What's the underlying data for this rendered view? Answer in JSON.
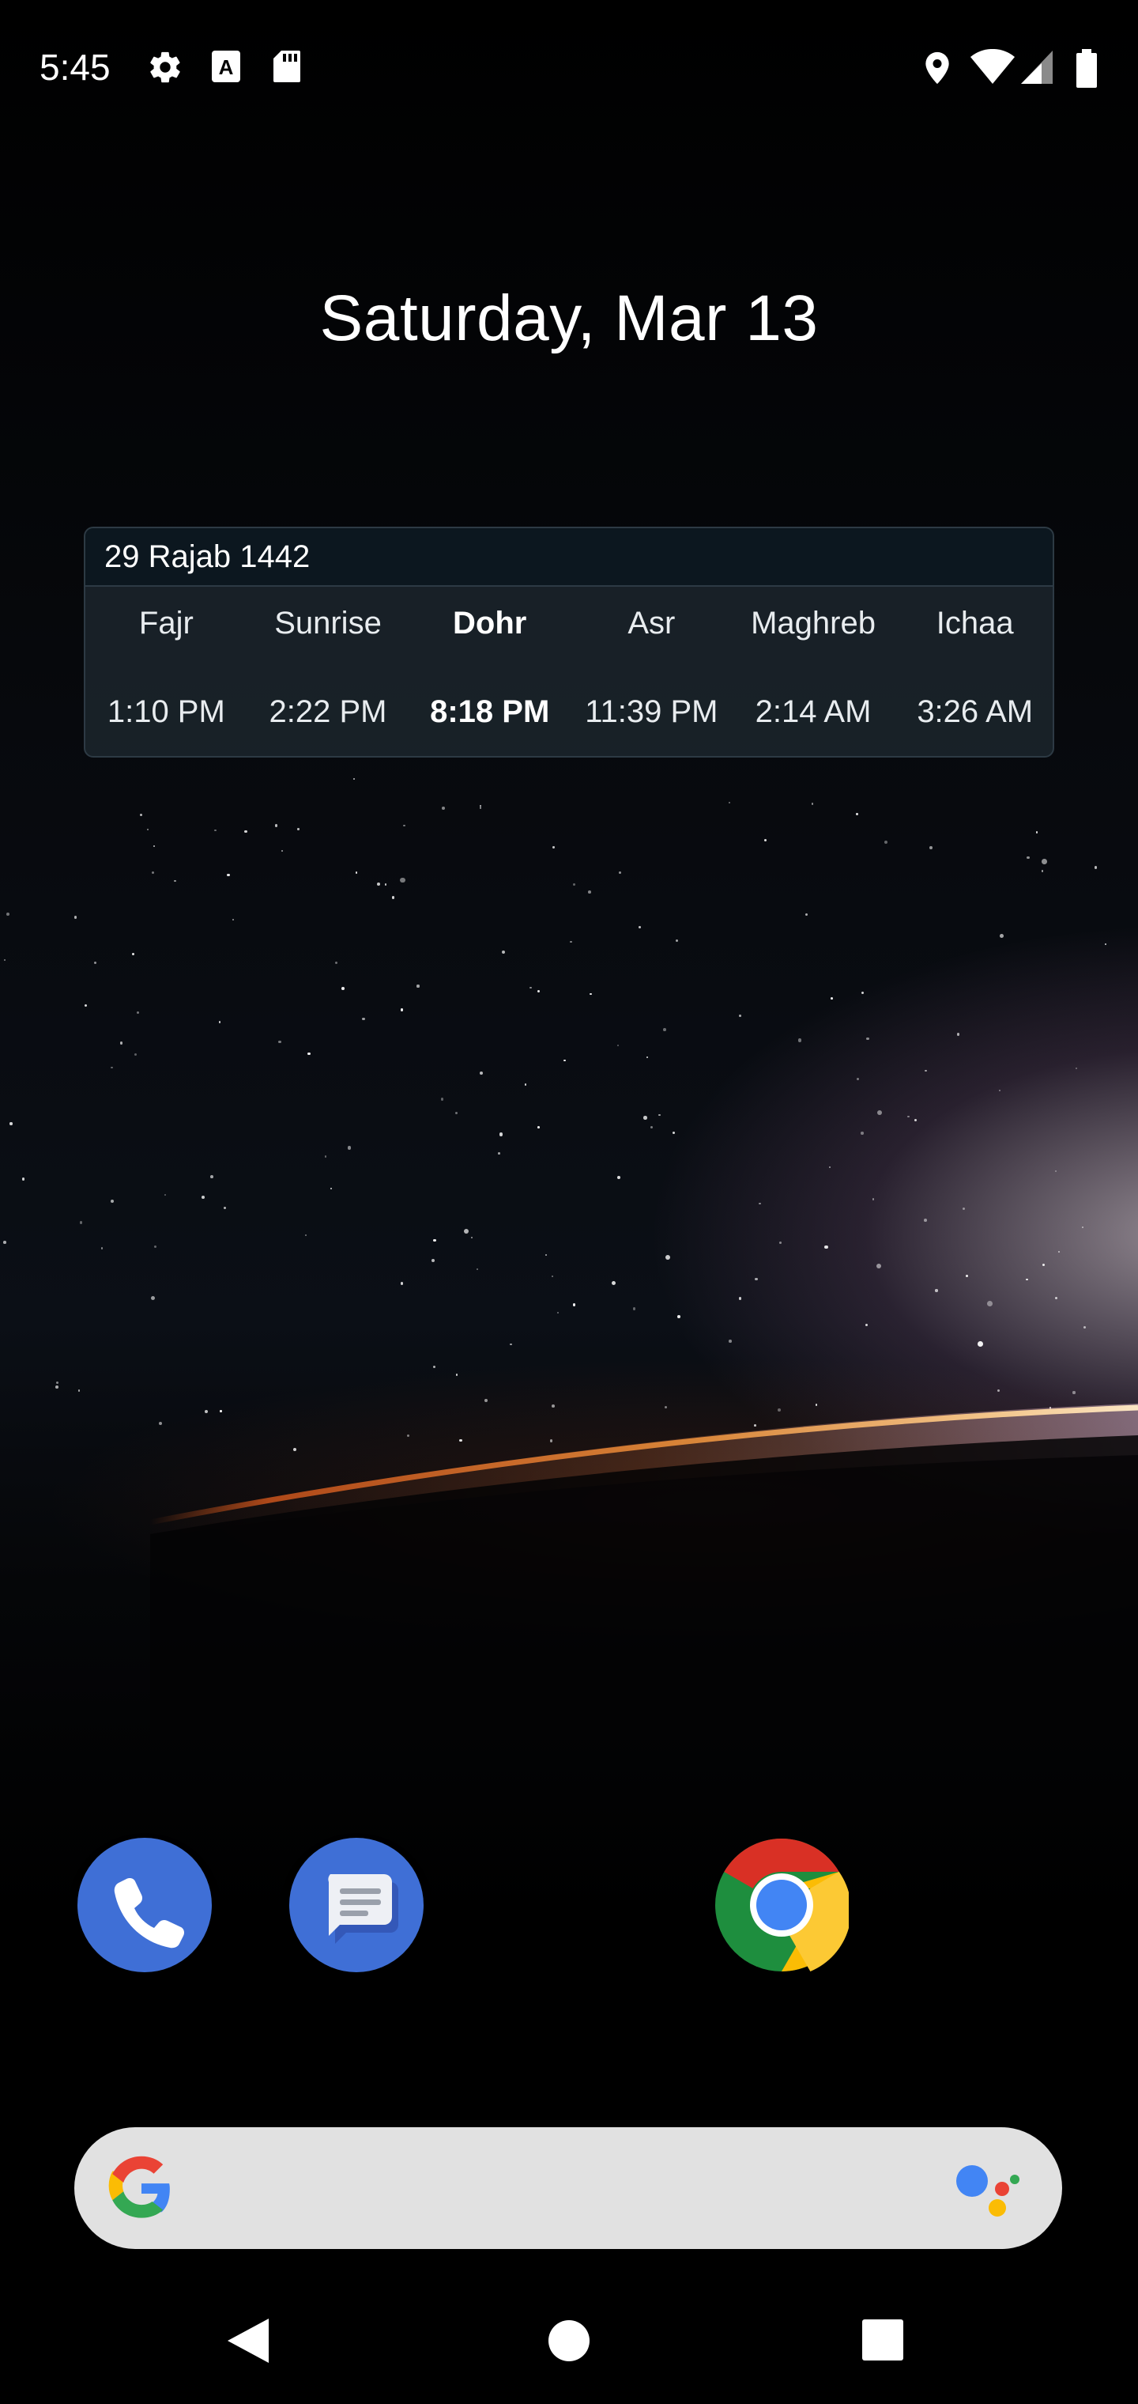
{
  "status_bar": {
    "time": "5:45",
    "left_icons": [
      "settings-icon",
      "a-letter-icon",
      "sd-card-icon"
    ],
    "right_icons": [
      "location-icon",
      "wifi-icon",
      "cell-signal-icon",
      "battery-icon"
    ]
  },
  "home": {
    "date": "Saturday, Mar 13"
  },
  "prayer_widget": {
    "hijri_date": "29 Rajab 1442",
    "prayers": [
      {
        "name": "Fajr",
        "time": "1:10 PM"
      },
      {
        "name": "Sunrise",
        "time": "2:22 PM"
      },
      {
        "name": "Dohr",
        "time": "8:18 PM"
      },
      {
        "name": "Asr",
        "time": "11:39 PM"
      },
      {
        "name": "Maghreb",
        "time": "2:14 AM"
      },
      {
        "name": "Ichaa",
        "time": "3:26 AM"
      }
    ],
    "highlighted": "Dohr"
  },
  "dock": {
    "apps": [
      "phone-icon",
      "messages-icon",
      "chrome-icon"
    ],
    "colors": {
      "phone": "#3f6fd6",
      "messages": "#3f6fd6"
    }
  },
  "search": {
    "icons": [
      "google-g-icon",
      "assistant-icon"
    ],
    "background": "#e1e1e1"
  },
  "nav": {
    "buttons": [
      "back-icon",
      "home-icon",
      "recents-icon"
    ]
  }
}
